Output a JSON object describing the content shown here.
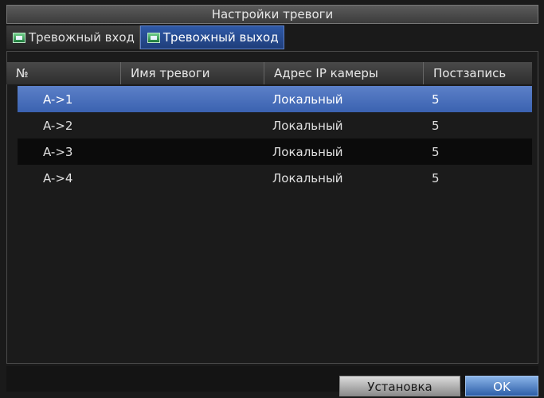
{
  "window": {
    "title": "Настройки тревоги"
  },
  "tabs": [
    {
      "label": "Тревожный вход",
      "icon": "alarm-input-icon",
      "active": false
    },
    {
      "label": "Тревожный выход",
      "icon": "alarm-output-icon",
      "active": true
    }
  ],
  "table": {
    "columns": [
      "№",
      "Имя тревоги",
      "Адрес IP камеры",
      "Постзапись"
    ],
    "rows": [
      {
        "no": "A->1",
        "name": "",
        "ip": "Локальный",
        "post": "5"
      },
      {
        "no": "A->2",
        "name": "",
        "ip": "Локальный",
        "post": "5"
      },
      {
        "no": "A->3",
        "name": "",
        "ip": "Локальный",
        "post": "5"
      },
      {
        "no": "A->4",
        "name": "",
        "ip": "Локальный",
        "post": "5"
      }
    ]
  },
  "buttons": {
    "setup": "Установка",
    "ok": "OK"
  },
  "colors": {
    "selected_row": "#4a70bc",
    "active_tab": "#2f5aa8",
    "background": "#1a1a1a"
  }
}
